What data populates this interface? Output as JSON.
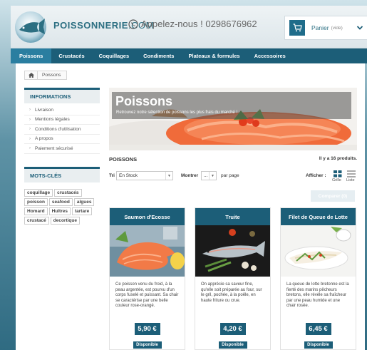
{
  "header": {
    "brand": "POISSONNERIE",
    "brand_suffix": ".COM",
    "phone_text": "Appelez-nous ! 0298676962",
    "cart_label": "Panier",
    "cart_empty": "(vide)"
  },
  "nav": {
    "items": [
      "Poissons",
      "Crustacés",
      "Coquillages",
      "Condiments",
      "Plateaux & formules",
      "Accessoires"
    ],
    "active": "Poissons"
  },
  "breadcrumb": {
    "current": "Poissons"
  },
  "sidebar": {
    "info_title": "INFORMATIONS",
    "info_items": [
      "Livraison",
      "Mentions légales",
      "Conditions d'utilisation",
      "A propos",
      "Paiement sécurisé"
    ],
    "tags_title": "MOTS-CLÉS",
    "tags": [
      "coquillage",
      "crustacés",
      "poisson",
      "seafood",
      "algues",
      "Homard",
      "Huîtres",
      "tartare",
      "crustacé",
      "decortique"
    ]
  },
  "banner": {
    "title": "Poissons",
    "subtitle": "Retrouvez notre sélection de poissons les plus frais du marché !"
  },
  "products_section": {
    "heading": "POISSONS",
    "count_text": "Il y a 16 produits.",
    "sort_label": "Tri",
    "sort_value": "En Stock",
    "show_label": "Montrer",
    "show_value": "...",
    "per_page": "par page",
    "display_label": "Afficher :",
    "grid_label": "Grille",
    "list_label": "Liste",
    "compare_label": "Comparer (0)"
  },
  "products": [
    {
      "name": "Saumon d'Ecosse",
      "description": "Ce poisson venu du froid, à la peau argentée, est pourvu d'un corps fuselé et puissant. Sa chair se caractérise par une belle couleur rose-orangé.",
      "price": "5,90 €",
      "stock": "Disponible"
    },
    {
      "name": "Truite",
      "description": "On apprécie sa saveur fine, qu'elle soit préparée au four, sur le gril, pochée, à la poêle, en haute friture ou crue.",
      "price": "4,20 €",
      "stock": "Disponible"
    },
    {
      "name": "Filet de Queue de Lotte",
      "description": "La queue de lotte bretonne est la fierté des marins pêcheurs bretons, elle révèle sa fraîcheur par une peau humide et une chair rosée.",
      "price": "6,45 €",
      "stock": "Disponible"
    }
  ],
  "colors": {
    "primary": "#1c5e78",
    "accent": "#2a7ea0",
    "brand_text": "#2c6f82"
  },
  "icons": {
    "logo": "fish-logo-icon",
    "phone": "phone-icon",
    "cart": "cart-icon",
    "chevron": "chevron-down-icon",
    "home": "home-icon",
    "grid": "grid-view-icon",
    "list": "list-view-icon"
  }
}
